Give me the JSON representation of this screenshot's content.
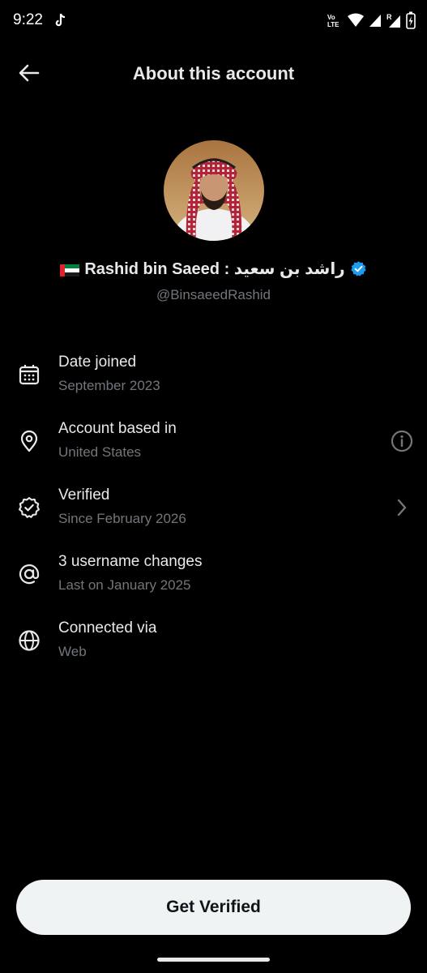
{
  "status_bar": {
    "time": "9:22",
    "icons": [
      "tiktok-icon",
      "volte-icon",
      "wifi-icon",
      "signal-icon",
      "signal-roaming-icon",
      "battery-charging-icon"
    ]
  },
  "header": {
    "title": "About this account",
    "back_icon": "arrow-left-icon"
  },
  "profile": {
    "flag": "🇦🇪",
    "display_name": "Rashid bin Saeed : راشد بن سعيد",
    "verified_icon": "verified-badge-icon",
    "handle": "@BinsaeedRashid"
  },
  "info_items": [
    {
      "icon": "calendar-icon",
      "title": "Date joined",
      "subtitle": "September 2023"
    },
    {
      "icon": "location-pin-icon",
      "title": "Account based in",
      "subtitle": "United States",
      "trailing_icon": "info-icon"
    },
    {
      "icon": "verified-badge-outline-icon",
      "title": "Verified",
      "subtitle": "Since February 2026",
      "trailing_icon": "chevron-right-icon"
    },
    {
      "icon": "at-sign-icon",
      "title": "3 username changes",
      "subtitle": "Last on January 2025"
    },
    {
      "icon": "globe-icon",
      "title": "Connected via",
      "subtitle": "Web"
    }
  ],
  "cta": {
    "label": "Get Verified"
  },
  "colors": {
    "background": "#000000",
    "primary_text": "#e7e9ea",
    "secondary_text": "#71767b",
    "verified_blue": "#1d9bf0",
    "button_bg": "#eff3f4"
  }
}
